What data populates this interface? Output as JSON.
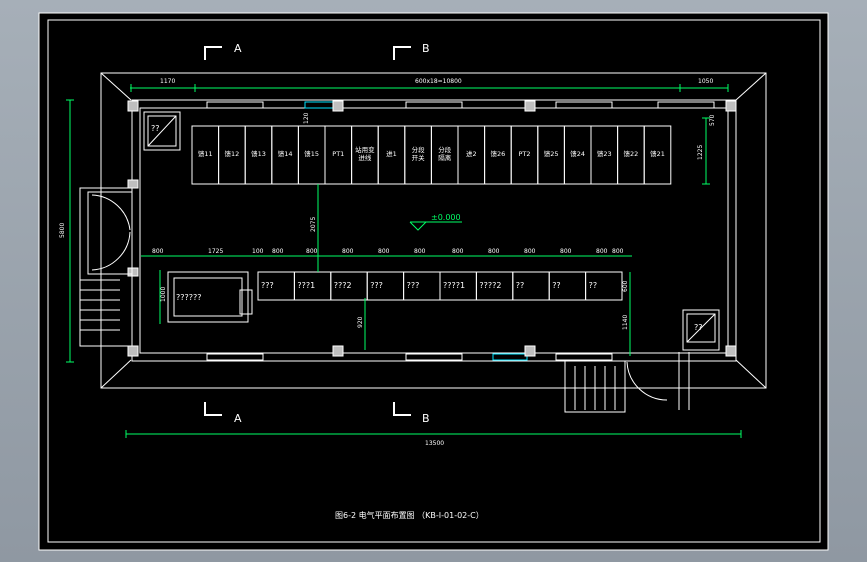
{
  "drawing": {
    "caption": "图6-2  电气平面布置图 （KB-I-01-02-C）",
    "level_mark": "±0.000",
    "section_marks": {
      "a_top": "A",
      "b_top": "B",
      "a_bottom": "A",
      "b_bottom": "B"
    },
    "dimensions": {
      "top_left": "1170",
      "top_middle": "600x18=10800",
      "top_right": "1050",
      "overall_bottom": "13500",
      "left_height": "5800",
      "right_a": "570",
      "right_b": "1225",
      "aisle": "2075",
      "right_c": "600",
      "right_d": "1140",
      "lower_stub": "120",
      "low_bottom": "920",
      "transformer_h": "1000",
      "row2": [
        "800",
        "1725",
        "100",
        "800",
        "800",
        "800",
        "800",
        "800",
        "800",
        "800",
        "800",
        "800",
        "800",
        "800"
      ]
    },
    "top_cabinets": [
      "馈11",
      "馈12",
      "馈13",
      "馈14",
      "馈15",
      "PT1",
      "站用变\n进线",
      "进1",
      "分段\n开关",
      "分段\n隔离",
      "进2",
      "馈26",
      "PT2",
      "馈25",
      "馈24",
      "馈23",
      "馈22",
      "馈21"
    ],
    "bottom_cabinets": [
      "???",
      "???1",
      "???2",
      "???",
      "???",
      "????1",
      "????2",
      "??",
      "??",
      "??"
    ],
    "transformer_label": "??????",
    "top_left_box_label": "??",
    "bottom_right_box_label": "??"
  }
}
